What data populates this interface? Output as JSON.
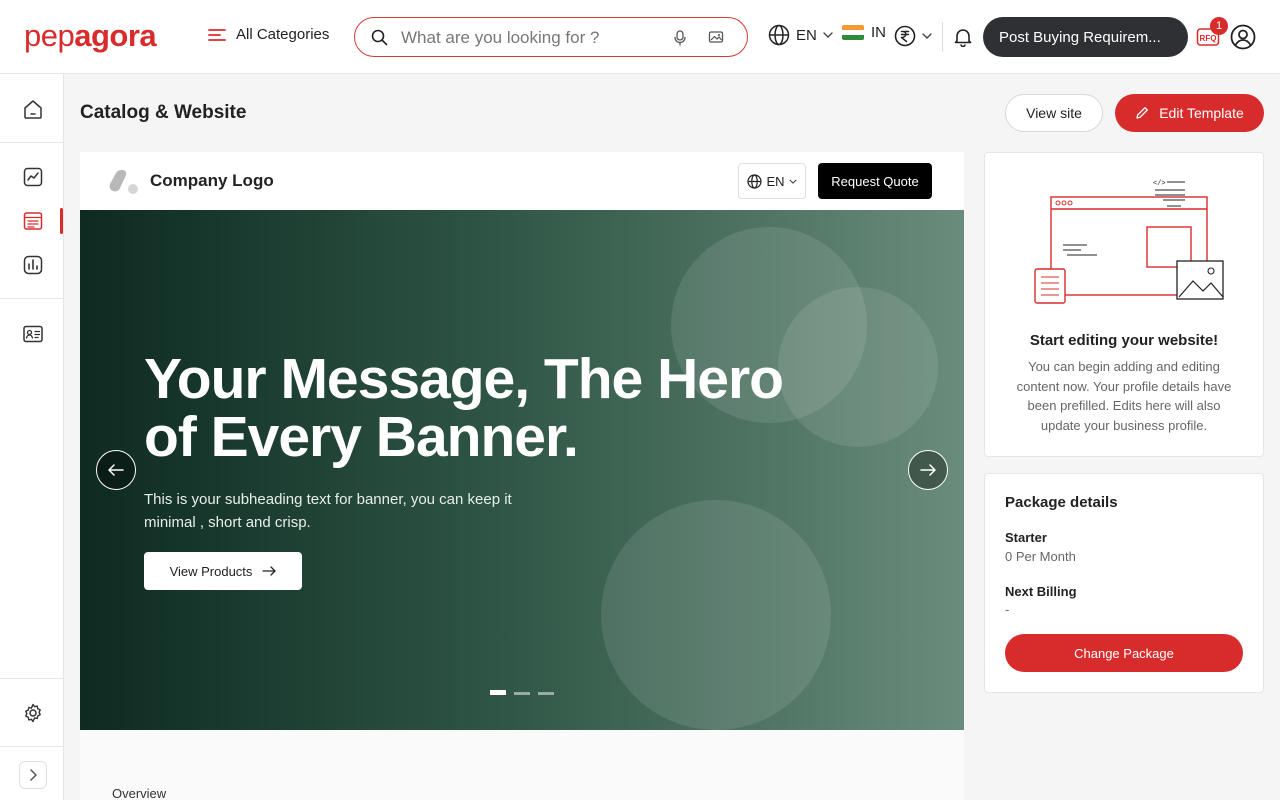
{
  "header": {
    "logo": {
      "part1": "pep",
      "part2": "agora"
    },
    "categories_label": "All Categories",
    "search": {
      "placeholder": "What are you looking for ?",
      "value": ""
    },
    "language": "EN",
    "country": "IN",
    "post_button": "Post Buying Requirem...",
    "rfq_count": "1",
    "rfq_label": "RFQ"
  },
  "sidebar": {
    "items": [
      "home",
      "analytics",
      "catalog-website",
      "reports",
      "contacts",
      "settings"
    ],
    "active": "catalog-website"
  },
  "page": {
    "title": "Catalog & Website",
    "view_site_label": "View site",
    "edit_template_label": "Edit Template"
  },
  "preview": {
    "logo_text": "Company Logo",
    "language": "EN",
    "quote_button": "Request Quote",
    "hero": {
      "title": "Your Message, The Hero of Every Banner.",
      "subtitle": "This is your subheading text for banner, you can keep it minimal , short and crisp.",
      "button": "View Products",
      "slides": 3,
      "active_slide": 1
    },
    "overview_label": "Overview"
  },
  "edit_card": {
    "title": "Start editing your website!",
    "text": "You can begin adding and editing content now. Your profile details have been prefilled. Edits here will also update your business profile."
  },
  "package": {
    "title": "Package details",
    "plan_label": "Starter",
    "plan_value": "0 Per Month",
    "billing_label": "Next Billing",
    "billing_value": "-",
    "button": "Change Package"
  },
  "colors": {
    "accent": "#d82c2c",
    "dark_button": "#2f3033",
    "hero_start": "#0e2a21",
    "hero_end": "#6a8c7c"
  }
}
